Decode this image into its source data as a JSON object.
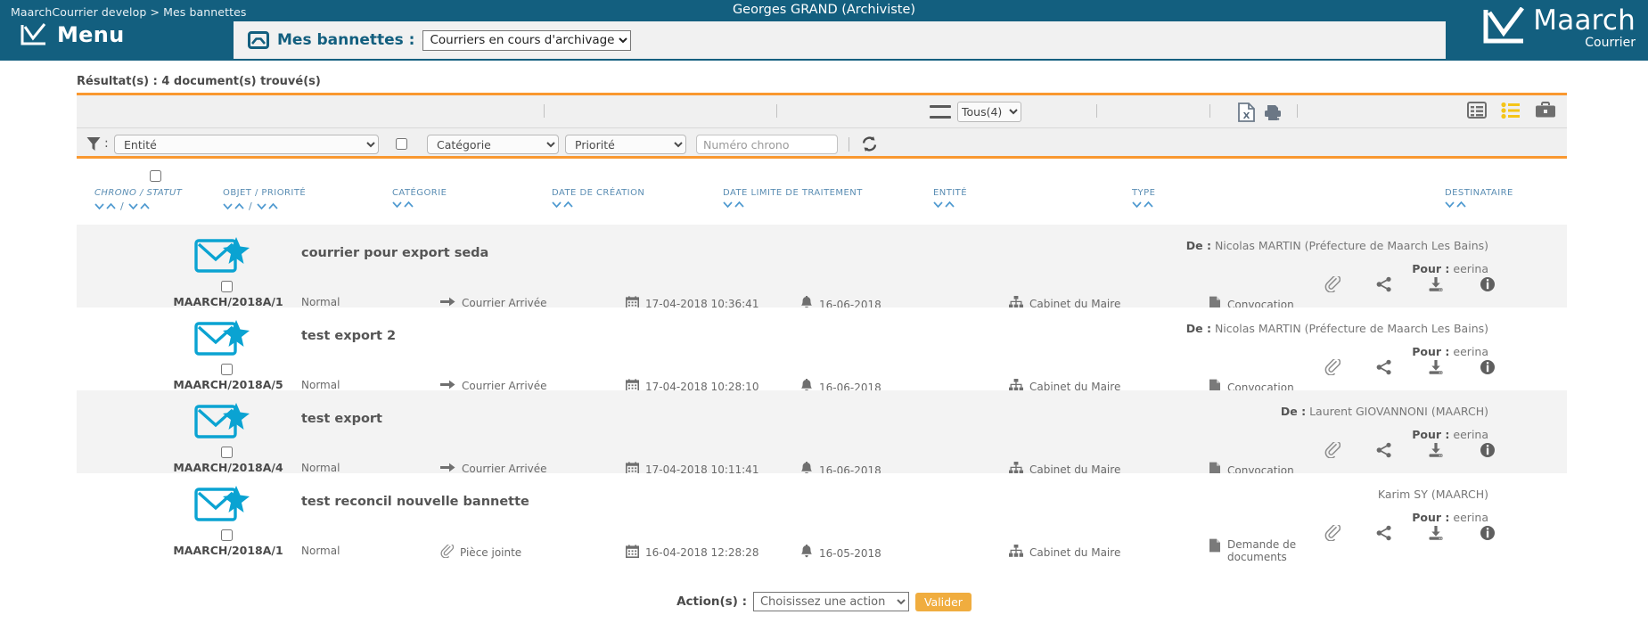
{
  "header": {
    "breadcrumb": "MaarchCourrier develop > Mes bannettes",
    "user": "Georges GRAND (Archiviste)",
    "menu_label": "Menu",
    "title_label": "Mes bannettes :",
    "bannette_selected": "Courriers en cours d'archivage",
    "bannette_options": [
      "Courriers en cours d'archivage"
    ],
    "brand_name": "Maarch",
    "brand_sub": "Courrier"
  },
  "results": {
    "label": "Résultat(s) : 4 document(s) trouvé(s)"
  },
  "toolbar": {
    "tous_selected": "Tous(4)",
    "tous_options": [
      "Tous(4)"
    ],
    "icons": {
      "hamburger": "hamburger-icon",
      "excel": "excel-export-icon",
      "print": "print-icon",
      "table_view": "table-view-icon",
      "list_view": "list-view-icon",
      "briefcase_view": "briefcase-view-icon"
    }
  },
  "filters": {
    "entite": "Entité",
    "entite_options": [
      "Entité"
    ],
    "categorie": "Catégorie",
    "categorie_options": [
      "Catégorie"
    ],
    "priorite": "Priorité",
    "priorite_options": [
      "Priorité"
    ],
    "chrono_placeholder": "Numéro chrono",
    "chrono_value": ""
  },
  "columns": [
    {
      "label": "CHRONO / STATUT",
      "sorts": 2,
      "italic": true
    },
    {
      "label": "OBJET / PRIORITÉ",
      "sorts": 2,
      "italic": false
    },
    {
      "label": "CATÉGORIE",
      "sorts": 1,
      "italic": false
    },
    {
      "label": "DATE DE CRÉATION",
      "sorts": 1,
      "italic": false
    },
    {
      "label": "DATE LIMITE DE TRAITEMENT",
      "sorts": 1,
      "italic": false
    },
    {
      "label": "ENTITÉ",
      "sorts": 1,
      "italic": false
    },
    {
      "label": "TYPE",
      "sorts": 1,
      "italic": false
    },
    {
      "label": "DESTINATAIRE",
      "sorts": 1,
      "italic": false
    }
  ],
  "rows": [
    {
      "chrono": "MAARCH/2018A/1",
      "subject": "courrier pour export seda",
      "priority": "Normal",
      "category": "Courrier Arrivée",
      "category_icon": "arrow-right-icon",
      "creation_date": "17-04-2018 10:36:41",
      "limit_date": "16-06-2018",
      "entity": "Cabinet du Maire",
      "type": "Convocation",
      "from_prefix": "De :",
      "from": "Nicolas MARTIN (Préfecture de Maarch Les Bains)",
      "to_prefix": "Pour :",
      "to": "eerina"
    },
    {
      "chrono": "MAARCH/2018A/5",
      "subject": "test export 2",
      "priority": "Normal",
      "category": "Courrier Arrivée",
      "category_icon": "arrow-right-icon",
      "creation_date": "17-04-2018 10:28:10",
      "limit_date": "16-06-2018",
      "entity": "Cabinet du Maire",
      "type": "Convocation",
      "from_prefix": "De :",
      "from": "Nicolas MARTIN (Préfecture de Maarch Les Bains)",
      "to_prefix": "Pour :",
      "to": "eerina"
    },
    {
      "chrono": "MAARCH/2018A/4",
      "subject": "test export",
      "priority": "Normal",
      "category": "Courrier Arrivée",
      "category_icon": "arrow-right-icon",
      "creation_date": "17-04-2018 10:11:41",
      "limit_date": "16-06-2018",
      "entity": "Cabinet du Maire",
      "type": "Convocation",
      "from_prefix": "De :",
      "from": "Laurent GIOVANNONI (MAARCH)",
      "to_prefix": "Pour :",
      "to": "eerina"
    },
    {
      "chrono": "MAARCH/2018A/1",
      "subject": "test reconcil nouvelle bannette",
      "priority": "Normal",
      "category": "Pièce jointe",
      "category_icon": "paperclip-icon",
      "creation_date": "16-04-2018 12:28:28",
      "limit_date": "16-05-2018",
      "entity": "Cabinet du Maire",
      "type": "Demande de documents",
      "from_prefix": "",
      "from": "Karim SY (MAARCH)",
      "to_prefix": "Pour :",
      "to": "eerina"
    }
  ],
  "row_actions": {
    "attachment": "paperclip-icon",
    "share": "share-icon",
    "download": "download-icon",
    "info": "info-icon"
  },
  "footer": {
    "action_label": "Action(s) :",
    "action_selected": "Choisissez une action",
    "action_options": [
      "Choisissez une action"
    ],
    "validate_label": "Valider"
  },
  "colors": {
    "header_bg": "#135f7f",
    "accent_orange": "#f99830",
    "link_blue": "#5a8db3",
    "envelope_cyan": "#0aa3d2",
    "button_orange": "#f0ad3f"
  }
}
